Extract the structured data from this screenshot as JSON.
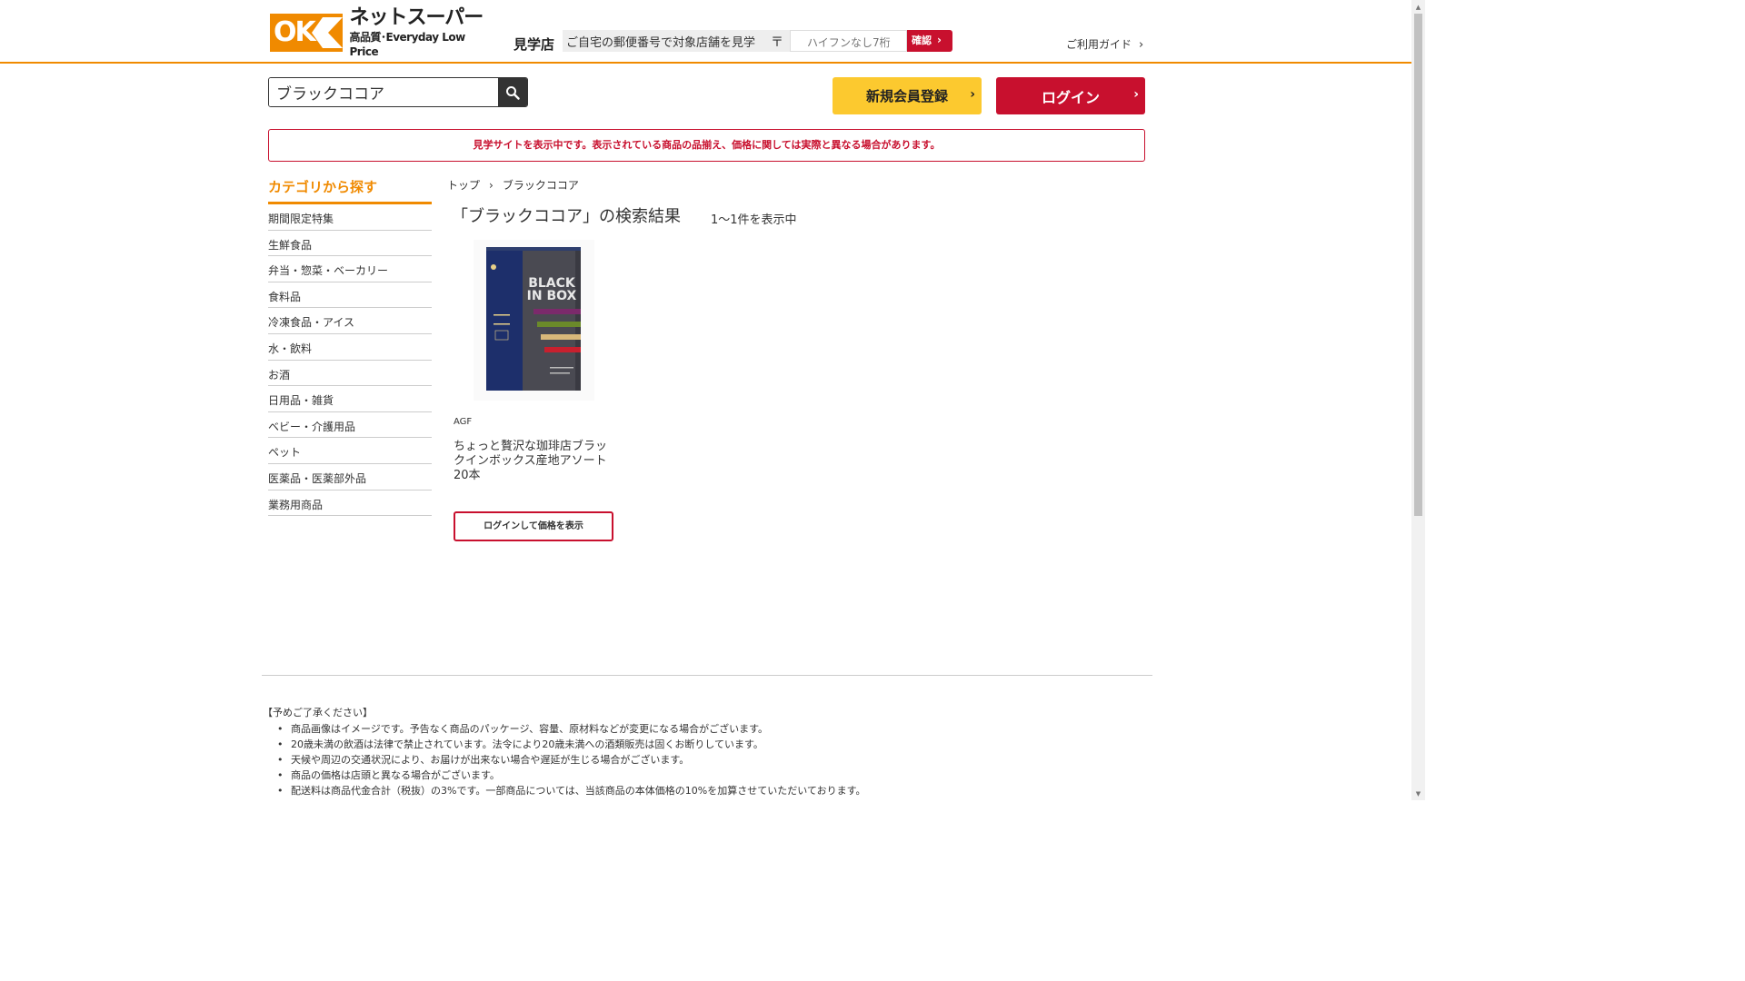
{
  "header": {
    "logo_badge": "OK",
    "logo_title": "ネットスーパー",
    "logo_sub": "高品質･Everyday Low Price",
    "store_label": "見学店",
    "zip_prompt": "ご自宅の郵便番号で対象店舗を見学",
    "zip_mark": "〒",
    "zip_placeholder": "ハイフンなし7桁",
    "zip_button": "確認",
    "guide_link": "ご利用ガイド"
  },
  "search": {
    "value": "ブラックココア"
  },
  "actions": {
    "register": "新規会員登録",
    "login": "ログイン"
  },
  "notice": "見学サイトを表示中です。表示されている商品の品揃え、価格に関しては実際と異なる場合があります。",
  "sidebar": {
    "title": "カテゴリから探す",
    "items": [
      {
        "label": "期間限定特集"
      },
      {
        "label": "生鮮食品"
      },
      {
        "label": "弁当・惣菜・ベーカリー"
      },
      {
        "label": "食料品"
      },
      {
        "label": "冷凍食品・アイス"
      },
      {
        "label": "水・飲料"
      },
      {
        "label": "お酒"
      },
      {
        "label": "日用品・雑貨"
      },
      {
        "label": "ベビー・介護用品"
      },
      {
        "label": "ペット"
      },
      {
        "label": "医薬品・医薬部外品"
      },
      {
        "label": "業務用商品"
      }
    ]
  },
  "breadcrumb": {
    "home": "トップ",
    "separator": "›",
    "current": "ブラックココア"
  },
  "results": {
    "title": "「ブラックココア」の検索結果",
    "count": "1〜1件を表示中"
  },
  "product": {
    "brand": "AGF",
    "name": "ちょっと贅沢な珈琲店ブラックインボックス産地アソート20本",
    "button": "ログインして価格を表示",
    "package_text_1": "BLACK",
    "package_text_2": "IN BOX"
  },
  "footer": {
    "heading": "【予めご了承ください】",
    "notes": [
      "商品画像はイメージです。予告なく商品のパッケージ、容量、原材料などが変更になる場合がございます。",
      "20歳未満の飲酒は法律で禁止されています。法令により20歳未満への酒類販売は固くお断りしています。",
      "天候や周辺の交通状況により、お届けが出来ない場合や遅延が生じる場合がございます。",
      "商品の価格は店頭と異なる場合がございます。",
      "配送料は商品代金合計（税抜）の3%です。一部商品については、当該商品の本体価格の10%を加算させていただいております。"
    ]
  },
  "colors": {
    "brand_orange": "#f08a00",
    "brand_red": "#c8102e",
    "register_yellow": "#fcc92f"
  }
}
